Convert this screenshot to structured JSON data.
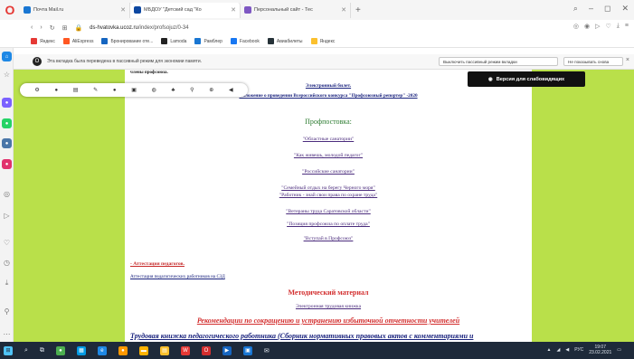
{
  "tabs": [
    {
      "label": "Почта Mail.ru",
      "color": "#1976d2"
    },
    {
      "label": "МБДОУ \"Детский сад \"Ко",
      "color": "#0d47a1"
    },
    {
      "label": "Персональный сайт - Тес",
      "color": "#7e57c2"
    }
  ],
  "address": {
    "host": "ds-hvatovka.ucoz.ru",
    "path": "/index/profsojuz/0-34"
  },
  "bookmarks": [
    {
      "label": "Яндекс",
      "color": "#e53935"
    },
    {
      "label": "AliExpress",
      "color": "#ff5722"
    },
    {
      "label": "Бронирование оте...",
      "color": "#1565c0"
    },
    {
      "label": "Lamoda",
      "color": "#222222"
    },
    {
      "label": "Рамблер",
      "color": "#1976d2"
    },
    {
      "label": "Facebook",
      "color": "#1877f2"
    },
    {
      "label": "Авиабилеты",
      "color": "#263238"
    },
    {
      "label": "Яндекс",
      "color": "#fbc02d"
    }
  ],
  "notification": {
    "text": "Эта вкладка была переведена в пассивный режим для экономии памяти.",
    "disable_button": "Выключить пассивный режим вкладки",
    "dont_show_button": "Не показывать снова",
    "close": "×"
  },
  "vision_button": "Версия для слабовидящих",
  "page": {
    "cut_heading": "члены профсоюза.",
    "ticket_link": "Электронный билет.",
    "contest_link": "Положение о проведении Всероссийского конкурса \"Профсоюзный репортер\" -2020",
    "profpost_title": "Профпостовка:",
    "profpost_links": [
      "\"Областные санатории\"",
      "\"Как живешь, молодой педагог\"",
      "\"Российские санатории\"",
      "\"Семейный отдых на берегу Черного моря\"",
      "\"Работник - знай свои права по охране труда\"",
      "\"Ветераны труда Саратовской области\"",
      "\"Позиция профсоюза по оплате труда\"",
      "\"Вступай в Профсоюз\""
    ],
    "attestation_link": "- Аттестация педагогов.",
    "attestation_sub": "Аттестация педагогических работников на СЗД",
    "method_title": "Методический материал",
    "workbook_link": "Электронная трудовая книжка",
    "recommendations": "Рекомендации по сокращению и устранению избыточной отчетности учителей",
    "labor_book": "Трудовая книжка педагогического работника (Сборник нормативных правовых актов с комментариями и"
  },
  "taskbar": {
    "lang": "РУС",
    "time": "19:07",
    "date": "23.02.2021"
  }
}
